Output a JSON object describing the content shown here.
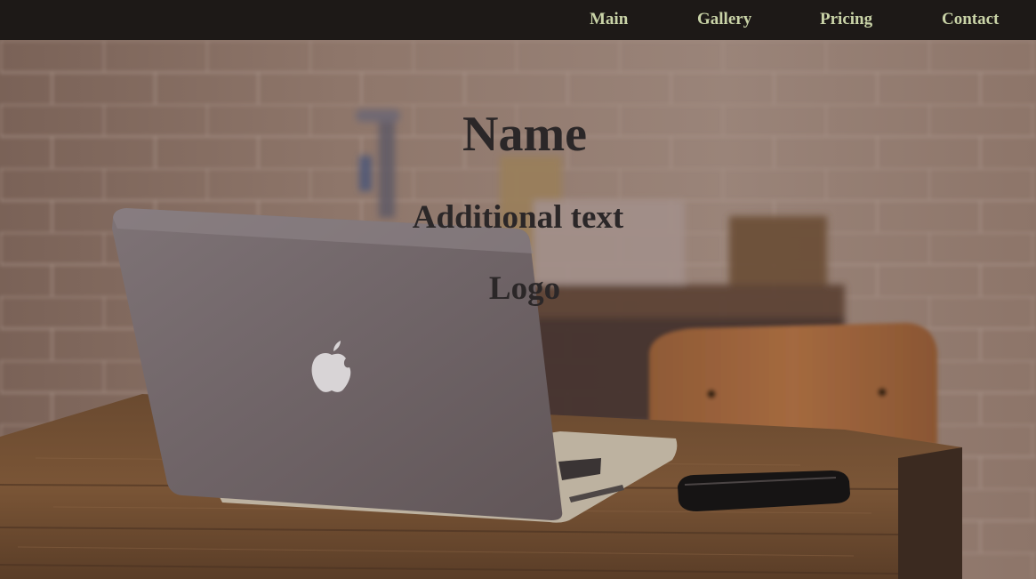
{
  "nav": {
    "items": [
      {
        "label": "Main"
      },
      {
        "label": "Gallery"
      },
      {
        "label": "Pricing"
      },
      {
        "label": "Contact"
      }
    ]
  },
  "hero": {
    "name": "Name",
    "additional_text": "Additional text",
    "logo": "Logo"
  },
  "colors": {
    "nav_background": "#1d1917",
    "nav_link": "#c9d3a7",
    "hero_text": "#2b2728"
  },
  "icons": [
    "apple-logo-icon"
  ]
}
